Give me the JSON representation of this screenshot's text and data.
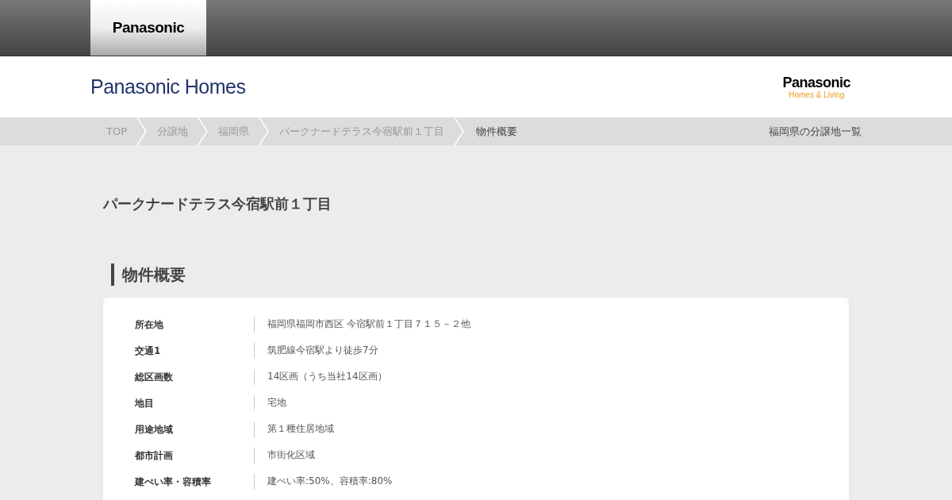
{
  "global_header": {
    "logo": "Panasonic"
  },
  "site_header": {
    "brand": "Panasonic Homes",
    "corporate_logo": {
      "name": "Panasonic",
      "tagline": "Homes & Living"
    }
  },
  "breadcrumb": {
    "items": [
      {
        "label": "TOP",
        "selected": false
      },
      {
        "label": "分譲地",
        "selected": false
      },
      {
        "label": "福岡県",
        "selected": false
      },
      {
        "label": "パークナードテラス今宿駅前１丁目",
        "selected": false
      },
      {
        "label": "物件概要",
        "selected": true
      }
    ],
    "side_link": "福岡県の分譲地一覧"
  },
  "page_title": "パークナードテラス今宿駅前１丁目",
  "section": {
    "heading": "物件概要",
    "rows": [
      {
        "label": "所在地",
        "value": "福岡県福岡市西区 今宿駅前１丁目７１５－２他"
      },
      {
        "label": "交通1",
        "value": "筑肥線今宿駅より徒歩7分"
      },
      {
        "label": "総区画数",
        "value": "14区画（うち当社14区画）"
      },
      {
        "label": "地目",
        "value": "宅地"
      },
      {
        "label": "用途地域",
        "value": "第１種住居地域"
      },
      {
        "label": "都市計画",
        "value": "市街化区域"
      },
      {
        "label": "建ぺい率・容積率",
        "value": "建ぺい率:50%、容積率:80%"
      }
    ]
  }
}
